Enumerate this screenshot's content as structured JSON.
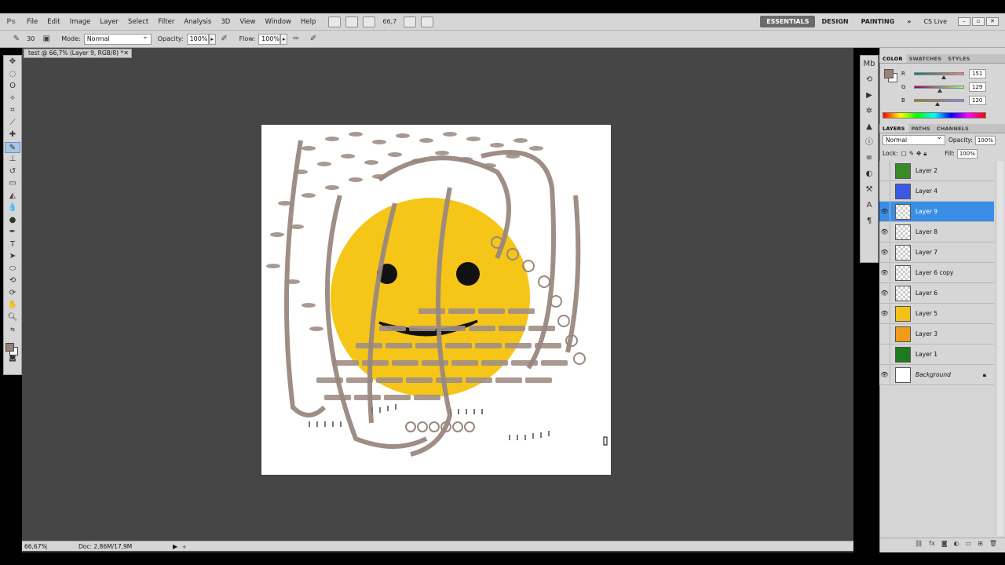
{
  "app": {
    "logo": "Ps",
    "menus": [
      "File",
      "Edit",
      "Image",
      "Layer",
      "Select",
      "Filter",
      "Analysis",
      "3D",
      "View",
      "Window",
      "Help"
    ],
    "zoom_readout": "66,7",
    "workspaces": [
      "ESSENTIALS",
      "DESIGN",
      "PAINTING"
    ],
    "workspace_more": "»",
    "cs_live": "CS Live"
  },
  "options": {
    "brush_size": "30",
    "mode_label": "Mode:",
    "mode_value": "Normal",
    "opacity_label": "Opacity:",
    "opacity_value": "100%",
    "flow_label": "Flow:",
    "flow_value": "100%"
  },
  "document": {
    "tab_title": "test @ 66,7% (Layer 9, RGB/8) *",
    "status_zoom": "66,67%",
    "status_doc": "Doc: 2,86M/17,9M"
  },
  "color_panel": {
    "tabs": [
      "COLOR",
      "SWATCHES",
      "STYLES"
    ],
    "channels": [
      {
        "letter": "R",
        "value": "151",
        "level": 0.59
      },
      {
        "letter": "G",
        "value": "129",
        "level": 0.51
      },
      {
        "letter": "B",
        "value": "120",
        "level": 0.47
      }
    ],
    "foreground": "#978178"
  },
  "layers_panel": {
    "tabs": [
      "LAYERS",
      "PATHS",
      "CHANNELS"
    ],
    "blend_mode": "Normal",
    "opacity_label": "Opacity:",
    "opacity_value": "100%",
    "lock_label": "Lock:",
    "fill_label": "Fill:",
    "fill_value": "100%",
    "layers": [
      {
        "name": "Layer 2",
        "visible": false,
        "thumb": "#3a8a2a"
      },
      {
        "name": "Layer 4",
        "visible": false,
        "thumb": "#3a5ae6"
      },
      {
        "name": "Layer 9",
        "visible": true,
        "selected": true,
        "thumb": ""
      },
      {
        "name": "Layer 8",
        "visible": true,
        "thumb": ""
      },
      {
        "name": "Layer 7",
        "visible": true,
        "thumb": ""
      },
      {
        "name": "Layer 6 copy",
        "visible": true,
        "thumb": ""
      },
      {
        "name": "Layer 6",
        "visible": true,
        "thumb": ""
      },
      {
        "name": "Layer 5",
        "visible": true,
        "thumb": "#f2c21a"
      },
      {
        "name": "Layer 3",
        "visible": false,
        "thumb": "#f29a1a"
      },
      {
        "name": "Layer 1",
        "visible": false,
        "thumb": "#1e7a1e"
      },
      {
        "name": "Background",
        "visible": true,
        "thumb": "#ffffff",
        "italic": true,
        "locked": true
      }
    ]
  }
}
